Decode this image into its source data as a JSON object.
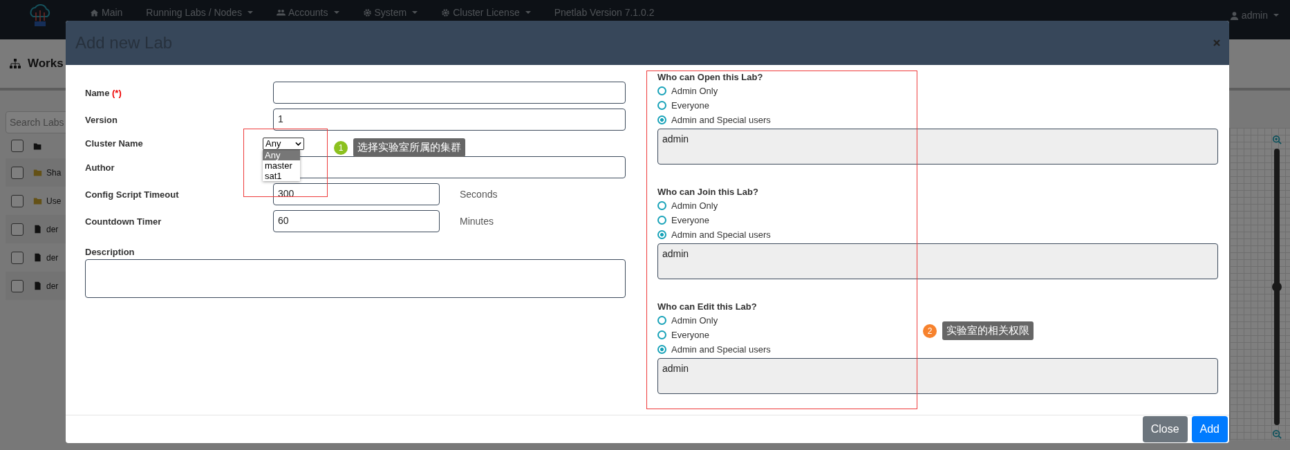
{
  "navbar": {
    "items": [
      {
        "label": "Main",
        "caret": false
      },
      {
        "label": "Running Labs / Nodes",
        "caret": true
      },
      {
        "label": "Accounts",
        "caret": true
      },
      {
        "label": "System",
        "caret": true
      },
      {
        "label": "Cluster License",
        "caret": true
      },
      {
        "label": "Pnetlab Version 7.1.0.2",
        "caret": false
      }
    ],
    "user": "admin"
  },
  "workspace_title": "Works",
  "search": {
    "placeholder": "Search Labs"
  },
  "select_all": {
    "checked": false
  },
  "files": [
    {
      "name": "Sha",
      "kind": "folder",
      "checked": false
    },
    {
      "name": "Use",
      "kind": "folder",
      "checked": false
    },
    {
      "name": "der",
      "kind": "file",
      "checked": false
    },
    {
      "name": "der",
      "kind": "file",
      "checked": false
    },
    {
      "name": "der",
      "kind": "file",
      "checked": false
    }
  ],
  "zoom_slider": {
    "level": 0.5
  },
  "modal": {
    "title": "Add new Lab",
    "fields": [
      {
        "label": "Name",
        "required": "(*)",
        "kind": "text"
      },
      {
        "label": "Version",
        "kind": "text",
        "value": "1"
      },
      {
        "label": "Cluster Name",
        "kind": "select",
        "value": "Any",
        "options": [
          {
            "label": "Any",
            "selected": true
          },
          {
            "label": "master",
            "selected": false
          },
          {
            "label": "sat1",
            "selected": false
          }
        ]
      },
      {
        "label": "Author",
        "kind": "text"
      },
      {
        "label": "Config Script Timeout",
        "kind": "short",
        "value": "300",
        "unit": "Seconds"
      },
      {
        "label": "Countdown Timer",
        "kind": "short",
        "value": "60",
        "unit": "Minutes"
      },
      {
        "label": "Description",
        "kind": "textarea"
      }
    ],
    "permissions": [
      {
        "title": "Who can Open this Lab?",
        "options": [
          {
            "label": "Admin Only",
            "selected": false
          },
          {
            "label": "Everyone",
            "selected": false
          },
          {
            "label": "Admin and Special users",
            "selected": true
          }
        ],
        "users": "admin"
      },
      {
        "title": "Who can Join this Lab?",
        "options": [
          {
            "label": "Admin Only",
            "selected": false
          },
          {
            "label": "Everyone",
            "selected": false
          },
          {
            "label": "Admin and Special users",
            "selected": true
          }
        ],
        "users": "admin"
      },
      {
        "title": "Who can Edit this Lab?",
        "options": [
          {
            "label": "Admin Only",
            "selected": false
          },
          {
            "label": "Everyone",
            "selected": false
          },
          {
            "label": "Admin and Special users",
            "selected": true
          }
        ],
        "users": "admin"
      }
    ],
    "buttons": [
      {
        "label": "Close",
        "kind": "secondary"
      },
      {
        "label": "Add",
        "kind": "primary"
      }
    ]
  },
  "annotations": [
    {
      "number": "1",
      "text": "选择实验室所属的集群",
      "color": "#8cc11f"
    },
    {
      "number": "2",
      "text": "实验室的相关权限",
      "color": "#f7822d"
    }
  ]
}
